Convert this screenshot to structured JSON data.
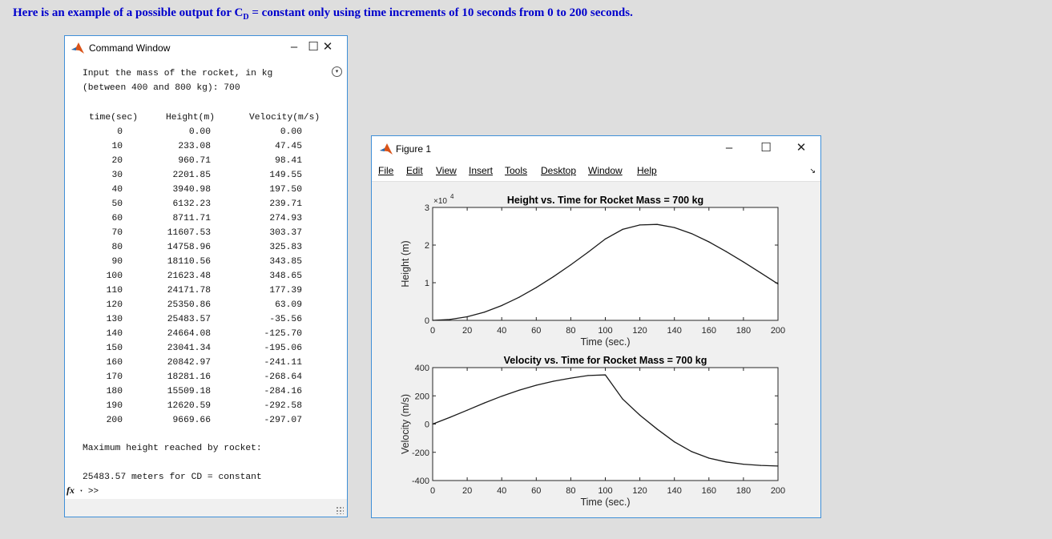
{
  "heading": {
    "pre": "Here is an example of a possible output for C",
    "sub": "D",
    "post": " = constant only using time increments of 10 seconds from 0 to 200 seconds."
  },
  "command_window": {
    "title": "Command Window",
    "minimize_label": "–",
    "maximize_label": "☐",
    "close_label": "✕",
    "collapse_label": "▾",
    "prompt_line1": "Input the mass of the rocket, in kg",
    "prompt_line2": "(between 400 and 800 kg): 700",
    "table_headers": [
      "time(sec)",
      "Height(m)",
      "Velocity(m/s)"
    ],
    "table_rows": [
      [
        "0",
        "0.00",
        "0.00"
      ],
      [
        "10",
        "233.08",
        "47.45"
      ],
      [
        "20",
        "960.71",
        "98.41"
      ],
      [
        "30",
        "2201.85",
        "149.55"
      ],
      [
        "40",
        "3940.98",
        "197.50"
      ],
      [
        "50",
        "6132.23",
        "239.71"
      ],
      [
        "60",
        "8711.71",
        "274.93"
      ],
      [
        "70",
        "11607.53",
        "303.37"
      ],
      [
        "80",
        "14758.96",
        "325.83"
      ],
      [
        "90",
        "18110.56",
        "343.85"
      ],
      [
        "100",
        "21623.48",
        "348.65"
      ],
      [
        "110",
        "24171.78",
        "177.39"
      ],
      [
        "120",
        "25350.86",
        "63.09"
      ],
      [
        "130",
        "25483.57",
        "-35.56"
      ],
      [
        "140",
        "24664.08",
        "-125.70"
      ],
      [
        "150",
        "23041.34",
        "-195.06"
      ],
      [
        "160",
        "20842.97",
        "-241.11"
      ],
      [
        "170",
        "18281.16",
        "-268.64"
      ],
      [
        "180",
        "15509.18",
        "-284.16"
      ],
      [
        "190",
        "12620.59",
        "-292.58"
      ],
      [
        "200",
        "9669.66",
        "-297.07"
      ]
    ],
    "max_height_label": "Maximum height reached by rocket:",
    "max_height_result": "25483.57 meters for CD = constant",
    "fx_label": "fx",
    "prompt": ">>"
  },
  "figure": {
    "title": "Figure 1",
    "minimize_label": "–",
    "maximize_label": "☐",
    "close_label": "✕",
    "dock_label": "↘",
    "menu": [
      "File",
      "Edit",
      "View",
      "Insert",
      "Tools",
      "Desktop",
      "Window",
      "Help"
    ]
  },
  "colors": {
    "matlab_logo": "#d95319",
    "heading": "#0000cc",
    "window_border": "#3f8fd8"
  },
  "chart_data": [
    {
      "type": "line",
      "title": "Height vs. Time for Rocket Mass = 700 kg",
      "xlabel": "Time (sec.)",
      "ylabel": "Height (m)",
      "exponent_label": "×10",
      "exponent_power": "4",
      "xlim": [
        0,
        200
      ],
      "ylim": [
        0,
        30000
      ],
      "xticks": [
        0,
        20,
        40,
        60,
        80,
        100,
        120,
        140,
        160,
        180,
        200
      ],
      "yticks": [
        0,
        10000,
        20000,
        30000
      ],
      "ytick_labels": [
        "0",
        "1",
        "2",
        "3"
      ],
      "grid": false,
      "x": [
        0,
        10,
        20,
        30,
        40,
        50,
        60,
        70,
        80,
        90,
        100,
        110,
        120,
        130,
        140,
        150,
        160,
        170,
        180,
        190,
        200
      ],
      "y": [
        0,
        233.08,
        960.71,
        2201.85,
        3940.98,
        6132.23,
        8711.71,
        11607.53,
        14758.96,
        18110.56,
        21623.48,
        24171.78,
        25350.86,
        25483.57,
        24664.08,
        23041.34,
        20842.97,
        18281.16,
        15509.18,
        12620.59,
        9669.66
      ]
    },
    {
      "type": "line",
      "title": "Velocity vs. Time for Rocket Mass = 700 kg",
      "xlabel": "Time (sec.)",
      "ylabel": "Velocity (m/s)",
      "xlim": [
        0,
        200
      ],
      "ylim": [
        -400,
        400
      ],
      "xticks": [
        0,
        20,
        40,
        60,
        80,
        100,
        120,
        140,
        160,
        180,
        200
      ],
      "yticks": [
        -400,
        -200,
        0,
        200,
        400
      ],
      "ytick_labels": [
        "-400",
        "-200",
        "0",
        "200",
        "400"
      ],
      "grid": false,
      "x": [
        0,
        10,
        20,
        30,
        40,
        50,
        60,
        70,
        80,
        90,
        100,
        110,
        120,
        130,
        140,
        150,
        160,
        170,
        180,
        190,
        200
      ],
      "y": [
        0,
        47.45,
        98.41,
        149.55,
        197.5,
        239.71,
        274.93,
        303.37,
        325.83,
        343.85,
        348.65,
        177.39,
        63.09,
        -35.56,
        -125.7,
        -195.06,
        -241.11,
        -268.64,
        -284.16,
        -292.58,
        -297.07
      ]
    }
  ]
}
